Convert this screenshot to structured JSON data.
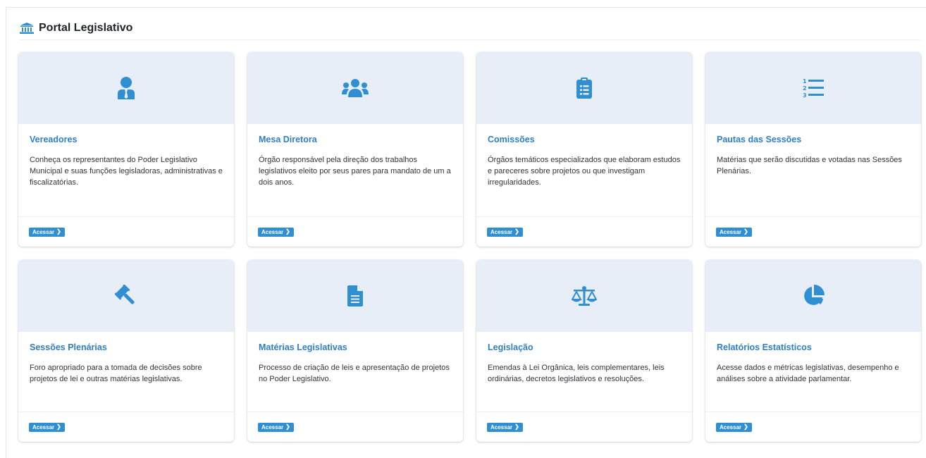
{
  "portal": {
    "title": "Portal Legislativo",
    "icon": "institution-icon"
  },
  "colors": {
    "accent": "#2f8fd2",
    "title": "#2f7fc4",
    "card_top": "#e8eef7"
  },
  "cards": [
    {
      "title": "Vereadores",
      "icon": "user-tie-icon",
      "desc": "Conheça os representantes do Poder Legislativo Municipal e suas funções legisladoras, administrativas e fiscalizatórias.",
      "button": "Acessar"
    },
    {
      "title": "Mesa Diretora",
      "icon": "users-icon",
      "desc": "Órgão responsável pela direção dos trabalhos legislativos eleito por seus pares para mandato de um a dois anos.",
      "button": "Acessar"
    },
    {
      "title": "Comissões",
      "icon": "clipboard-list-icon",
      "desc": "Órgãos temáticos especializados que elaboram estudos e pareceres sobre projetos ou que investigam irregularidades.",
      "button": "Acessar"
    },
    {
      "title": "Pautas das Sessões",
      "icon": "numbered-list-icon",
      "desc": "Matérias que serão discutidas e votadas nas Sessões Plenárias.",
      "button": "Acessar"
    },
    {
      "title": "Sessões Plenárias",
      "icon": "gavel-icon",
      "desc": "Foro apropriado para a tomada de decisões sobre projetos de lei e outras matérias legislativas.",
      "button": "Acessar"
    },
    {
      "title": "Matérias Legislativas",
      "icon": "file-text-icon",
      "desc": "Processo de criação de leis e apresentação de projetos no Poder Legislativo.",
      "button": "Acessar"
    },
    {
      "title": "Legislação",
      "icon": "balance-scale-icon",
      "desc": "Emendas à Lei Orgânica, leis complementares, leis ordinárias, decretos legislativos e resoluções.",
      "button": "Acessar"
    },
    {
      "title": "Relatórios Estatísticos",
      "icon": "chart-pie-icon",
      "desc": "Acesse dados e métricas legislativas, desempenho e análises sobre a atividade parlamentar.",
      "button": "Acessar"
    }
  ]
}
